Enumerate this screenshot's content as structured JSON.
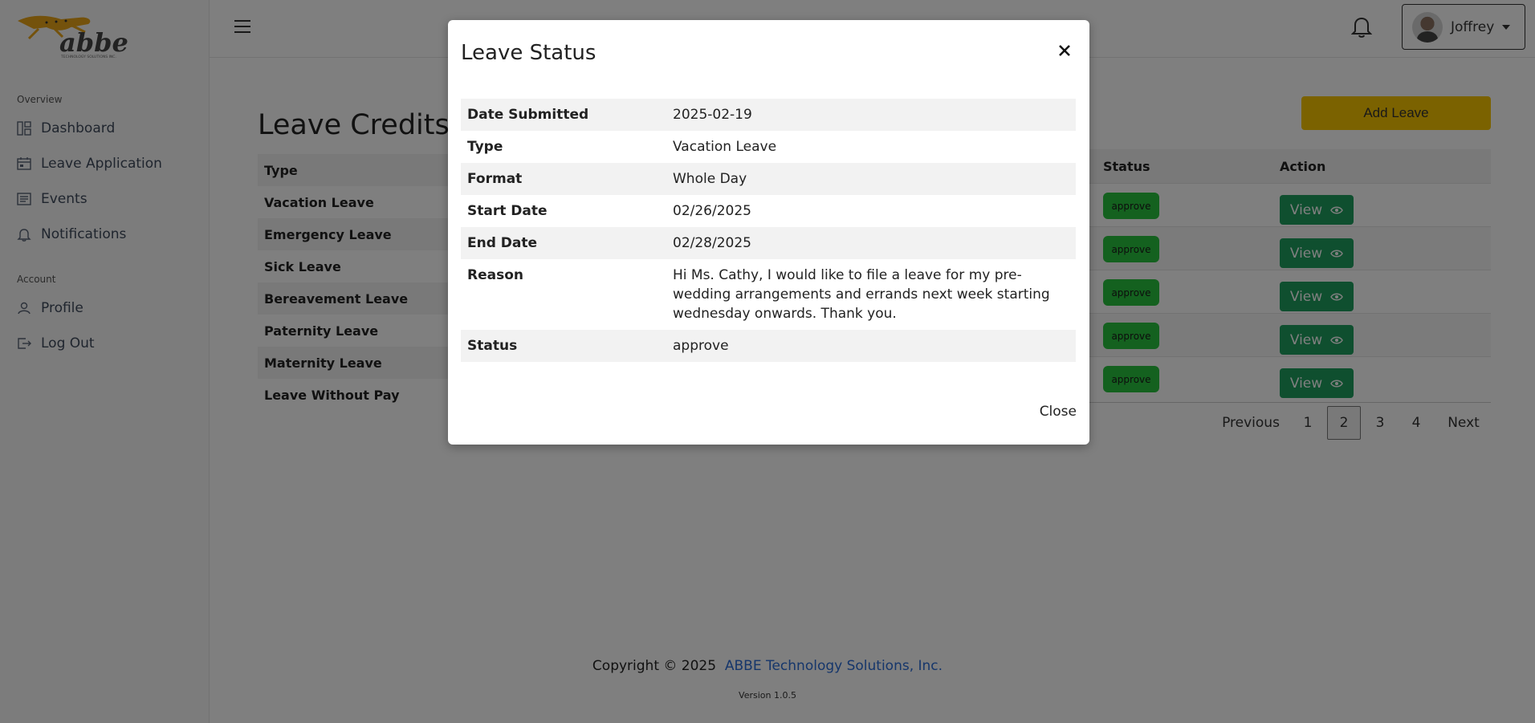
{
  "brand": {
    "logo_text": "abbe",
    "logo_subtext": "TECHNOLOGY SOLUTIONS INC."
  },
  "sidebar": {
    "sections": [
      {
        "title": "Overview",
        "items": [
          {
            "label": "Dashboard",
            "icon": "dashboard-icon"
          },
          {
            "label": "Leave Application",
            "icon": "calendar-icon"
          },
          {
            "label": "Events",
            "icon": "list-icon"
          },
          {
            "label": "Notifications",
            "icon": "bell-icon"
          }
        ]
      },
      {
        "title": "Account",
        "items": [
          {
            "label": "Profile",
            "icon": "user-icon"
          },
          {
            "label": "Log Out",
            "icon": "logout-icon"
          }
        ]
      }
    ]
  },
  "topbar": {
    "user_name": "Joffrey"
  },
  "main": {
    "title": "Leave Credits",
    "credits_header": "Type",
    "credit_types": [
      "Vacation Leave",
      "Emergency Leave",
      "Sick Leave",
      "Bereavement Leave",
      "Paternity Leave",
      "Maternity Leave",
      "Leave Without Pay"
    ],
    "add_leave_label": "Add Leave",
    "leaves_table": {
      "headers": {
        "status": "Status",
        "action": "Action"
      },
      "rows": [
        {
          "status": "approve",
          "action": "View"
        },
        {
          "status": "approve",
          "action": "View"
        },
        {
          "status": "approve",
          "action": "View"
        },
        {
          "status": "approve",
          "action": "View"
        },
        {
          "status": "approve",
          "action": "View"
        }
      ]
    },
    "pagination": {
      "previous": "Previous",
      "pages": [
        "1",
        "2",
        "3",
        "4"
      ],
      "current": "2",
      "next": "Next"
    }
  },
  "footer": {
    "copyright": "Copyright © 2025",
    "company": "ABBE Technology Solutions, Inc.",
    "version": "Version 1.0.5"
  },
  "modal": {
    "title": "Leave Status",
    "rows": [
      {
        "label": "Date Submitted",
        "value": "2025-02-19"
      },
      {
        "label": "Type",
        "value": "Vacation Leave"
      },
      {
        "label": "Format",
        "value": "Whole Day"
      },
      {
        "label": "Start Date",
        "value": "02/26/2025"
      },
      {
        "label": "End Date",
        "value": "02/28/2025"
      },
      {
        "label": "Reason",
        "value": "Hi Ms. Cathy, I would like to file a leave for my pre-wedding arrangements and errands next week starting wednesday onwards. Thank you."
      },
      {
        "label": "Status",
        "value": "approve"
      }
    ],
    "close_label": "Close"
  },
  "colors": {
    "accent": "#f6c400",
    "approve_badge": "#29c23e",
    "view_button": "#1e9e5e",
    "link": "#2b6cd6"
  }
}
